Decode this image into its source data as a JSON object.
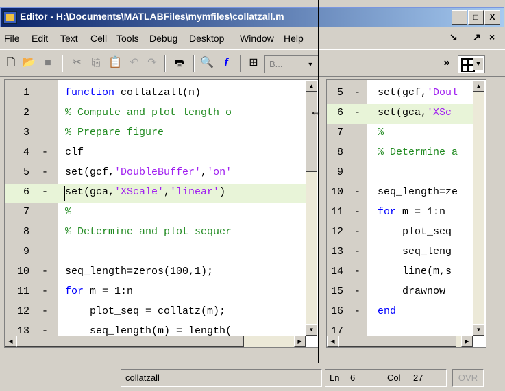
{
  "window": {
    "title": "Editor - H:\\Documents\\MATLABFiles\\mymfiles\\collatzall.m",
    "minimize": "_",
    "maximize": "□",
    "close": "X"
  },
  "menu": {
    "items": [
      "File",
      "Edit",
      "Text",
      "Cell",
      "Tools",
      "Debug",
      "Desktop",
      "Window",
      "Help"
    ],
    "right_icons": [
      "↘",
      "↗",
      "×"
    ]
  },
  "toolbar": {
    "style_combo": "B...",
    "more": "»"
  },
  "left_pane": {
    "lines": [
      {
        "n": "1",
        "dash": "",
        "code": [
          {
            "t": "function",
            "c": "kw"
          },
          {
            "t": " collatzall(n)",
            "c": ""
          }
        ]
      },
      {
        "n": "2",
        "dash": "",
        "code": [
          {
            "t": "% Compute and plot length o",
            "c": "cm"
          }
        ]
      },
      {
        "n": "3",
        "dash": "",
        "code": [
          {
            "t": "% Prepare figure",
            "c": "cm"
          }
        ]
      },
      {
        "n": "4",
        "dash": "-",
        "code": [
          {
            "t": "clf",
            "c": ""
          }
        ]
      },
      {
        "n": "5",
        "dash": "-",
        "code": [
          {
            "t": "set(gcf,",
            "c": ""
          },
          {
            "t": "'DoubleBuffer'",
            "c": "st"
          },
          {
            "t": ",",
            "c": ""
          },
          {
            "t": "'on'",
            "c": "st"
          }
        ]
      },
      {
        "n": "6",
        "dash": "-",
        "code": [
          {
            "t": "set(gca,",
            "c": ""
          },
          {
            "t": "'XScale'",
            "c": "st"
          },
          {
            "t": ",",
            "c": ""
          },
          {
            "t": "'linear'",
            "c": "st"
          },
          {
            "t": ")",
            "c": ""
          }
        ],
        "hl": true
      },
      {
        "n": "7",
        "dash": "",
        "code": [
          {
            "t": "%",
            "c": "cm"
          }
        ]
      },
      {
        "n": "8",
        "dash": "",
        "code": [
          {
            "t": "% Determine and plot sequer",
            "c": "cm"
          }
        ]
      },
      {
        "n": "9",
        "dash": "",
        "code": []
      },
      {
        "n": "10",
        "dash": "-",
        "code": [
          {
            "t": "seq_length=zeros(100,1);",
            "c": ""
          }
        ]
      },
      {
        "n": "11",
        "dash": "-",
        "code": [
          {
            "t": "for",
            "c": "kw"
          },
          {
            "t": " m = 1:n",
            "c": ""
          }
        ]
      },
      {
        "n": "12",
        "dash": "-",
        "code": [
          {
            "t": "    plot_seq = collatz(m);",
            "c": ""
          }
        ]
      },
      {
        "n": "13",
        "dash": "-",
        "code": [
          {
            "t": "    seq_length(m) = length(",
            "c": ""
          }
        ]
      }
    ]
  },
  "right_pane": {
    "lines": [
      {
        "n": "5",
        "dash": "-",
        "code": [
          {
            "t": "set(gcf,",
            "c": ""
          },
          {
            "t": "'Doul",
            "c": "st"
          }
        ]
      },
      {
        "n": "6",
        "dash": "-",
        "code": [
          {
            "t": "set(gca,",
            "c": ""
          },
          {
            "t": "'XSc",
            "c": "st"
          }
        ],
        "hl": true
      },
      {
        "n": "7",
        "dash": "",
        "code": [
          {
            "t": "%",
            "c": "cm"
          }
        ]
      },
      {
        "n": "8",
        "dash": "",
        "code": [
          {
            "t": "% Determine a",
            "c": "cm"
          }
        ]
      },
      {
        "n": "9",
        "dash": "",
        "code": []
      },
      {
        "n": "10",
        "dash": "-",
        "code": [
          {
            "t": "seq_length=ze",
            "c": ""
          }
        ]
      },
      {
        "n": "11",
        "dash": "-",
        "code": [
          {
            "t": "for",
            "c": "kw"
          },
          {
            "t": " m = 1:n",
            "c": ""
          }
        ]
      },
      {
        "n": "12",
        "dash": "-",
        "code": [
          {
            "t": "    plot_seq",
            "c": ""
          }
        ]
      },
      {
        "n": "13",
        "dash": "-",
        "code": [
          {
            "t": "    seq_leng",
            "c": ""
          }
        ]
      },
      {
        "n": "14",
        "dash": "-",
        "code": [
          {
            "t": "    line(m,s",
            "c": ""
          }
        ]
      },
      {
        "n": "15",
        "dash": "-",
        "code": [
          {
            "t": "    drawnow",
            "c": ""
          }
        ]
      },
      {
        "n": "16",
        "dash": "-",
        "code": [
          {
            "t": "end",
            "c": "kw"
          }
        ]
      },
      {
        "n": "17",
        "dash": "",
        "code": []
      }
    ]
  },
  "status": {
    "filename": "collatzall",
    "ln_label": "Ln",
    "ln": "6",
    "col_label": "Col",
    "col": "27",
    "ovr": "OVR"
  }
}
